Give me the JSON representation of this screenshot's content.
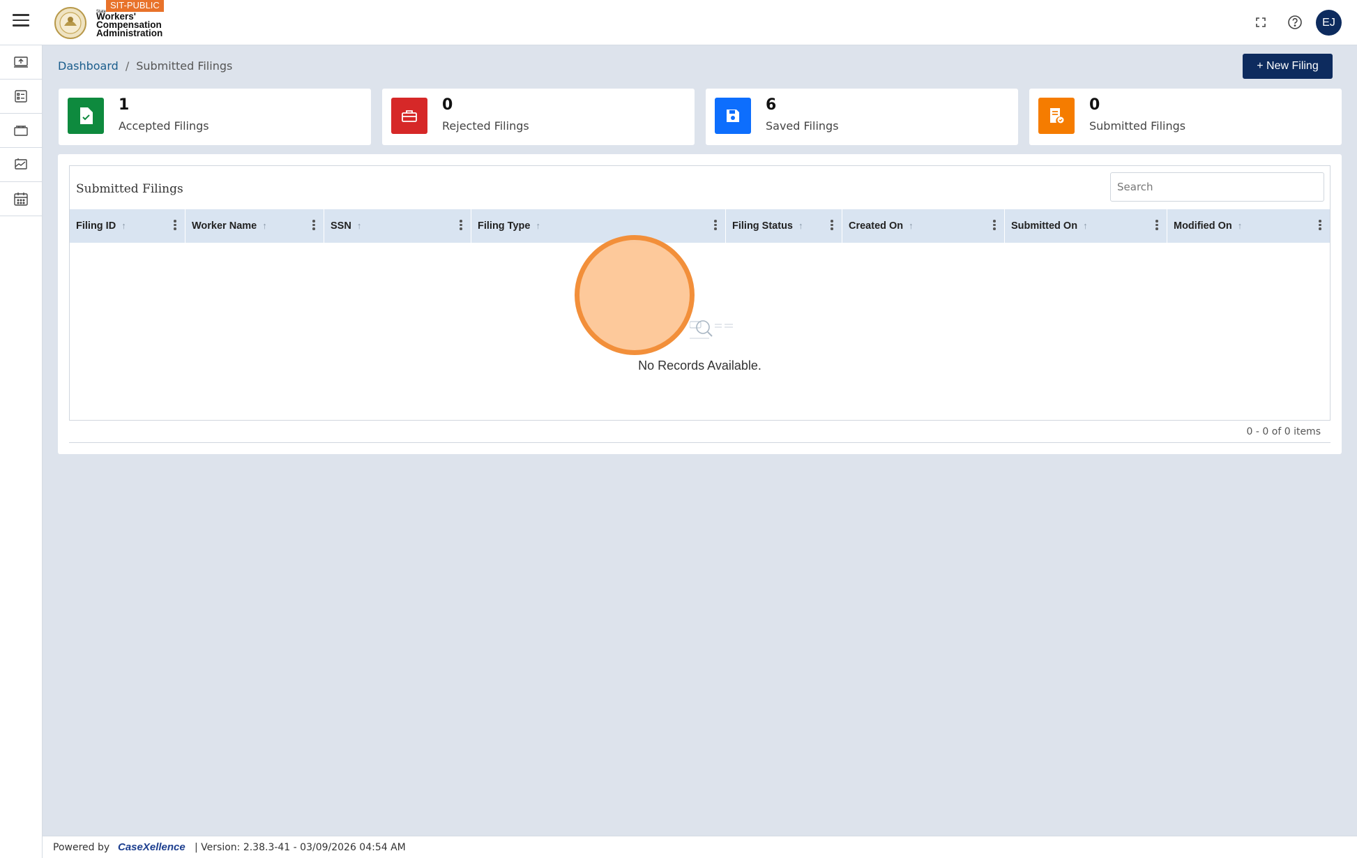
{
  "header": {
    "env_badge": "SIT-PUBLIC",
    "logo_small": "State",
    "logo_lines": [
      "Workers'",
      "Compensation",
      "Administration"
    ],
    "avatar_initials": "EJ"
  },
  "breadcrumb": {
    "root": "Dashboard",
    "separator": "/",
    "current": "Submitted Filings"
  },
  "actions": {
    "new_filing": "+ New Filing"
  },
  "stats": [
    {
      "count": "1",
      "label": "Accepted Filings",
      "color": "#0e8a3e",
      "icon": "file-check-icon"
    },
    {
      "count": "0",
      "label": "Rejected Filings",
      "color": "#d62828",
      "icon": "briefcase-icon"
    },
    {
      "count": "6",
      "label": "Saved Filings",
      "color": "#0d6efd",
      "icon": "save-icon"
    },
    {
      "count": "0",
      "label": "Submitted Filings",
      "color": "#f57c00",
      "icon": "file-submitted-icon"
    }
  ],
  "grid": {
    "title": "Submitted Filings",
    "search_placeholder": "Search",
    "columns": [
      "Filing ID",
      "Worker Name",
      "SSN",
      "Filing Type",
      "Filing Status",
      "Created On",
      "Submitted On",
      "Modified On"
    ],
    "sort_glyph": "↑",
    "empty_message": "No Records Available.",
    "pager": "0 - 0 of 0 items"
  },
  "footer": {
    "powered_by": "Powered by",
    "brand": "CaseXellence",
    "version": "|   Version: 2.38.3-41 - 03/09/2026 04:54 AM"
  }
}
